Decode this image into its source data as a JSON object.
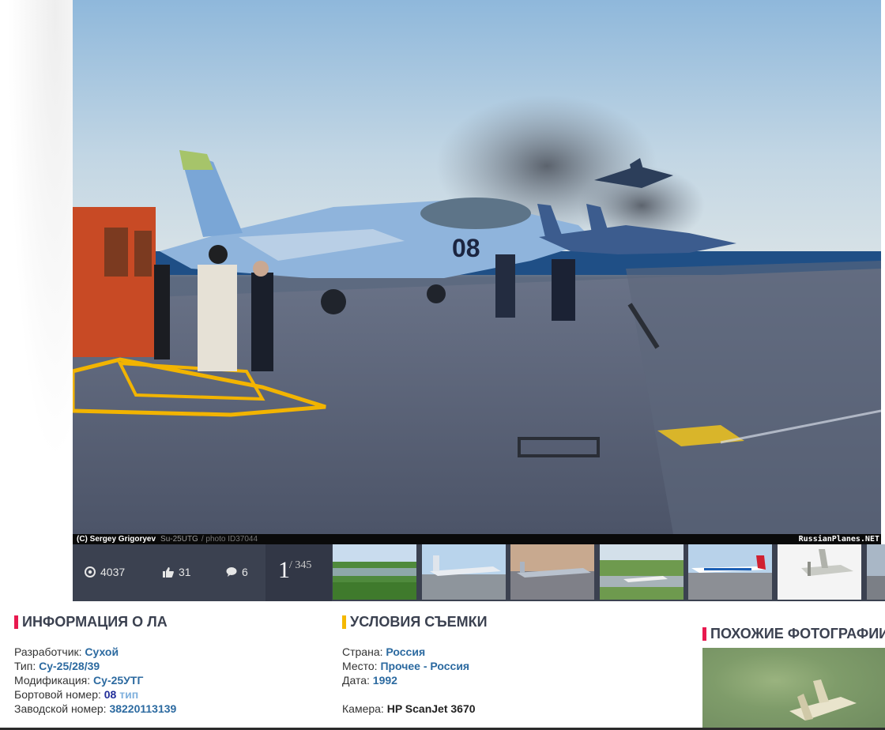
{
  "photo": {
    "aircraft_tail_number": "08",
    "caption": {
      "author": "(C) Sergey Grigoryev",
      "model": "Su-25UTG",
      "photo_id": "/ photo ID37044",
      "site": "RussianPlanes.NET"
    }
  },
  "stats": {
    "views": "4037",
    "likes": "31",
    "comments": "6",
    "current_index": "1",
    "total": "/ 345"
  },
  "thumbnails": [
    {
      "name": "thumb-airfield-aerial"
    },
    {
      "name": "thumb-jet-apron"
    },
    {
      "name": "thumb-jet-runway"
    },
    {
      "name": "thumb-airshow"
    },
    {
      "name": "thumb-airliner-red-tail"
    },
    {
      "name": "thumb-turboprop"
    },
    {
      "name": "thumb-partial"
    }
  ],
  "info": {
    "title": "ИНФОРМАЦИЯ О ЛА",
    "developer_label": "Разработчик:",
    "developer_value": "Сухой",
    "type_label": "Тип:",
    "type_value": "Су-25/28/39",
    "mod_label": "Модификация:",
    "mod_value": "Су-25УТГ",
    "reg_label": "Бортовой номер:",
    "reg_value": "08",
    "reg_extra": "тип",
    "serial_label": "Заводской номер:",
    "serial_value": "38220113139"
  },
  "conditions": {
    "title": "УСЛОВИЯ СЪЕМКИ",
    "country_label": "Страна:",
    "country_value": "Россия",
    "place_label": "Место:",
    "place_value": "Прочее - Россия",
    "date_label": "Дата:",
    "date_value": "1992",
    "camera_label": "Камера:",
    "camera_value": "HP ScanJet 3670"
  },
  "similar": {
    "title": "ПОХОЖИЕ ФОТОГРАФИИ"
  }
}
